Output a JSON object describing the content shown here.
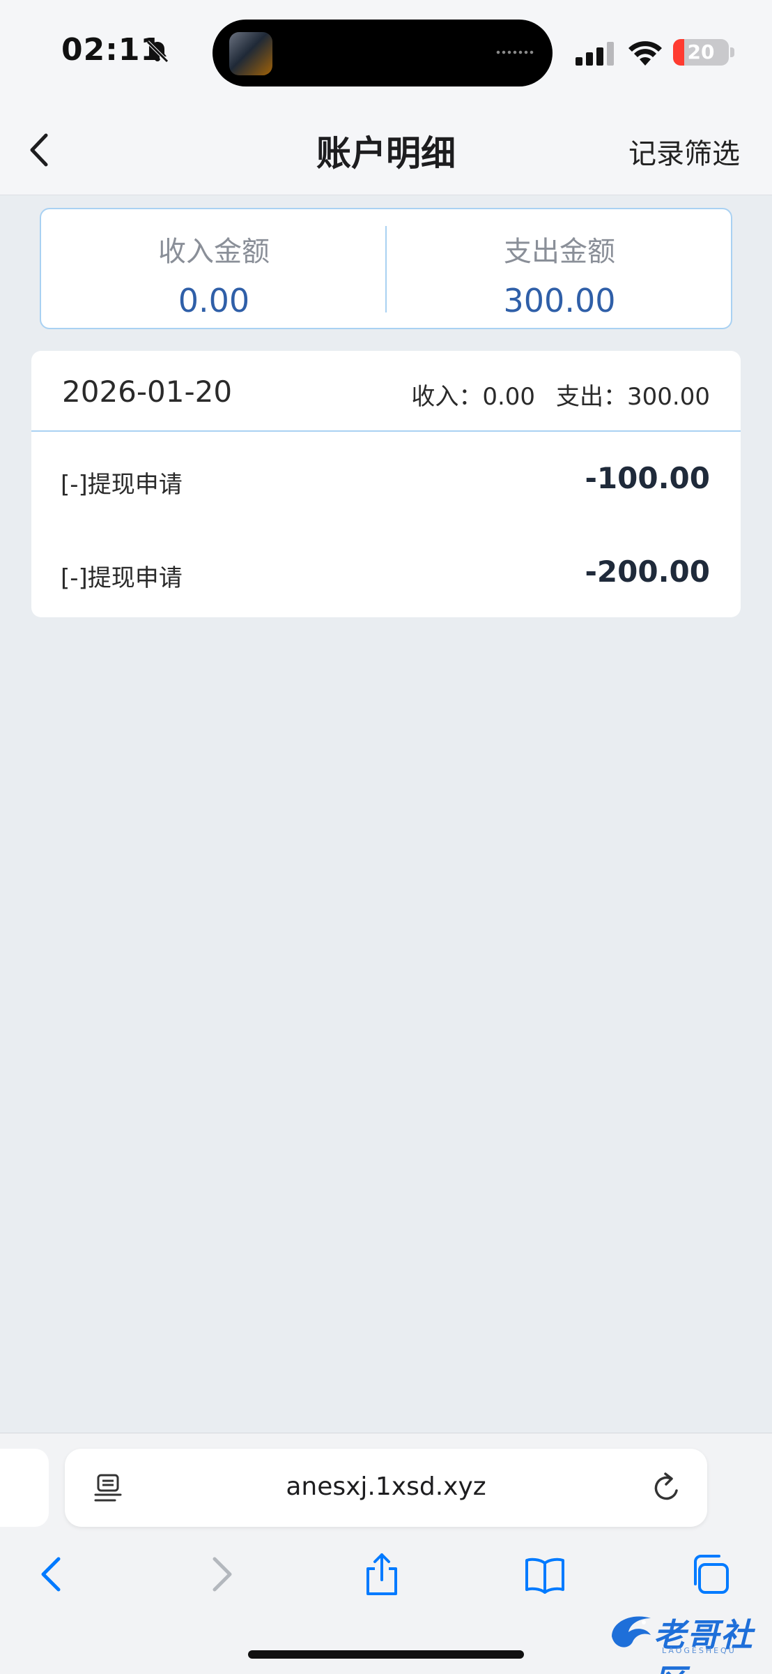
{
  "status_bar": {
    "time": "02:11",
    "battery_level": "20",
    "icons": [
      "bell-slash-icon",
      "signal-icon",
      "wifi-icon",
      "battery-icon"
    ]
  },
  "header": {
    "title": "账户明细",
    "filter_label": "记录筛选",
    "back_icon": "chevron-left-icon"
  },
  "summary": {
    "income_label": "收入金额",
    "income_value": "0.00",
    "expense_label": "支出金额",
    "expense_value": "300.00"
  },
  "records": [
    {
      "date": "2026-01-20",
      "income_text": "收入：0.00",
      "expense_text": "支出：300.00",
      "entries": [
        {
          "label": "[-]提现申请",
          "amount": "-100.00"
        },
        {
          "label": "[-]提现申请",
          "amount": "-200.00"
        }
      ]
    }
  ],
  "browser": {
    "url": "anesxj.1xsd.xyz",
    "toolbar_icons": [
      "back-icon",
      "forward-icon",
      "share-icon",
      "bookmarks-icon",
      "tabs-icon"
    ]
  },
  "watermark": {
    "text": "老哥社区",
    "subtext": "LAOGESHEQU"
  },
  "colors": {
    "accent_blue": "#2f5fa8",
    "border_blue": "#a9d1f2",
    "background": "#e9edf1",
    "ios_link_blue": "#007aff"
  }
}
